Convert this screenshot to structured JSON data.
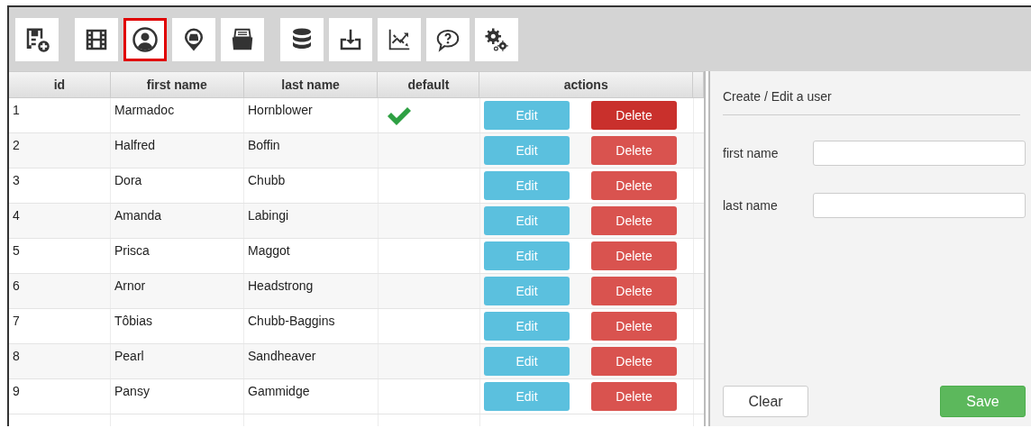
{
  "toolbar": [
    {
      "selected": false
    },
    {
      "selected": false
    },
    {
      "selected": true
    },
    {
      "selected": false
    },
    {
      "selected": false
    },
    {
      "selected": false
    },
    {
      "selected": false
    },
    {
      "selected": false
    },
    {
      "selected": false
    },
    {
      "selected": false
    }
  ],
  "table": {
    "columns": [
      "id",
      "first name",
      "last name",
      "default",
      "actions"
    ],
    "rows": [
      {
        "id": "1",
        "first_name": "Marmadoc",
        "last_name": "Hornblower",
        "default": true,
        "edit": "Edit",
        "delete": "Delete",
        "delete_active": true
      },
      {
        "id": "2",
        "first_name": "Halfred",
        "last_name": "Boffin",
        "default": false,
        "edit": "Edit",
        "delete": "Delete",
        "delete_active": false
      },
      {
        "id": "3",
        "first_name": "Dora",
        "last_name": "Chubb",
        "default": false,
        "edit": "Edit",
        "delete": "Delete",
        "delete_active": false
      },
      {
        "id": "4",
        "first_name": "Amanda",
        "last_name": "Labingi",
        "default": false,
        "edit": "Edit",
        "delete": "Delete",
        "delete_active": false
      },
      {
        "id": "5",
        "first_name": "Prisca",
        "last_name": "Maggot",
        "default": false,
        "edit": "Edit",
        "delete": "Delete",
        "delete_active": false
      },
      {
        "id": "6",
        "first_name": "Arnor",
        "last_name": "Headstrong",
        "default": false,
        "edit": "Edit",
        "delete": "Delete",
        "delete_active": false
      },
      {
        "id": "7",
        "first_name": "Tôbias",
        "last_name": "Chubb-Baggins",
        "default": false,
        "edit": "Edit",
        "delete": "Delete",
        "delete_active": false
      },
      {
        "id": "8",
        "first_name": "Pearl",
        "last_name": "Sandheaver",
        "default": false,
        "edit": "Edit",
        "delete": "Delete",
        "delete_active": false
      },
      {
        "id": "9",
        "first_name": "Pansy",
        "last_name": "Gammidge",
        "default": false,
        "edit": "Edit",
        "delete": "Delete",
        "delete_active": false
      }
    ]
  },
  "form": {
    "title": "Create / Edit a user",
    "fields": [
      {
        "label": "first name"
      },
      {
        "label": "last name"
      }
    ],
    "buttons": [
      {
        "label": "Clear",
        "kind": "default"
      },
      {
        "label": "Save",
        "kind": "primary"
      }
    ]
  }
}
